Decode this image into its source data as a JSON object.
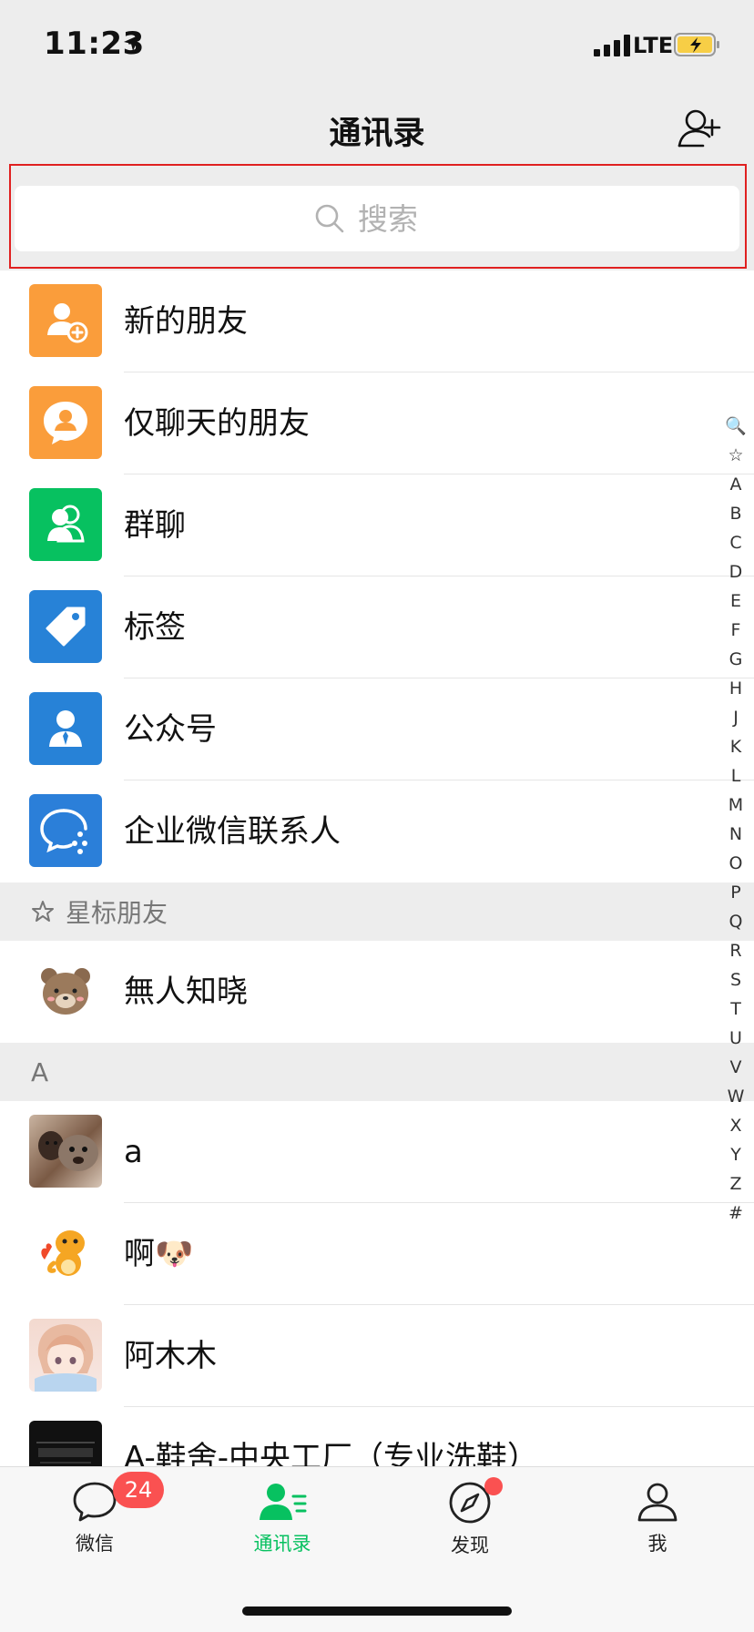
{
  "status": {
    "time": "11:23",
    "network": "LTE",
    "battery_color": "#f7ce46"
  },
  "nav": {
    "title": "通讯录"
  },
  "search": {
    "placeholder": "搜索"
  },
  "functions": [
    {
      "label": "新的朋友",
      "icon": "new-friend-icon",
      "color": "#fa9d3b"
    },
    {
      "label": "仅聊天的朋友",
      "icon": "chat-only-friend-icon",
      "color": "#fa9d3b"
    },
    {
      "label": "群聊",
      "icon": "group-chat-icon",
      "color": "#07c160"
    },
    {
      "label": "标签",
      "icon": "tag-icon",
      "color": "#2782d7"
    },
    {
      "label": "公众号",
      "icon": "official-account-icon",
      "color": "#2782d7"
    },
    {
      "label": "企业微信联系人",
      "icon": "wecom-contact-icon",
      "color": "#2b7fd9"
    }
  ],
  "starred": {
    "header": "星标朋友",
    "contacts": [
      {
        "name": "無人知晓"
      }
    ]
  },
  "section_a": {
    "header": "A",
    "contacts": [
      {
        "name": "a"
      },
      {
        "name": "啊🐶"
      },
      {
        "name": "阿木木"
      },
      {
        "name": "A-鞋舍-中央工厂（专业洗鞋）"
      }
    ]
  },
  "index": [
    "🔍",
    "☆",
    "A",
    "B",
    "C",
    "D",
    "E",
    "F",
    "G",
    "H",
    "J",
    "K",
    "L",
    "M",
    "N",
    "O",
    "P",
    "Q",
    "R",
    "S",
    "T",
    "U",
    "V",
    "W",
    "X",
    "Y",
    "Z",
    "#"
  ],
  "tabs": [
    {
      "label": "微信",
      "icon": "chat-bubble-icon",
      "badge": "24"
    },
    {
      "label": "通讯录",
      "icon": "contacts-icon",
      "active": true
    },
    {
      "label": "发现",
      "icon": "compass-icon",
      "dot": true
    },
    {
      "label": "我",
      "icon": "person-icon"
    }
  ],
  "colors": {
    "accent": "#07c160",
    "badge": "#fa5151",
    "highlight_border": "#e02020"
  }
}
